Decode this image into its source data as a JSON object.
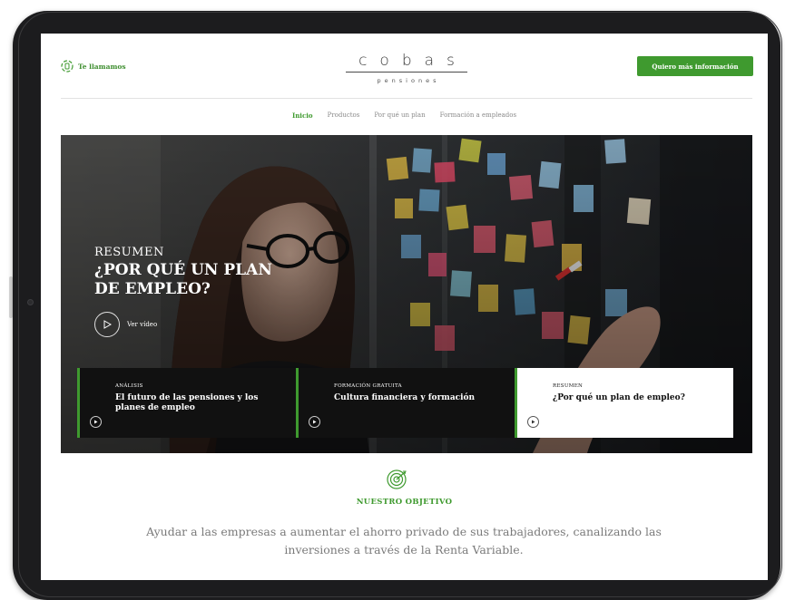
{
  "header": {
    "call_label": "Te llamamos",
    "logo_main": "cobas",
    "logo_sub": "pensiones",
    "cta_label": "Quiero más información"
  },
  "nav": {
    "items": [
      {
        "label": "Inicio",
        "active": true
      },
      {
        "label": "Productos",
        "active": false
      },
      {
        "label": "Por qué un plan",
        "active": false
      },
      {
        "label": "Formación a empleados",
        "active": false
      }
    ]
  },
  "hero": {
    "kicker": "RESUMEN",
    "title": "¿POR QUÉ UN PLAN DE EMPLEO?",
    "video_label": "Ver vídeo"
  },
  "cards": [
    {
      "kicker": "ANÁLISIS",
      "title": "El futuro de las pensiones y los planes de empleo",
      "style": "dark"
    },
    {
      "kicker": "FORMACIÓN GRATUITA",
      "title": "Cultura financiera y formación",
      "style": "dark"
    },
    {
      "kicker": "RESUMEN",
      "title": "¿Por qué un plan de empleo?",
      "style": "light"
    }
  ],
  "objective": {
    "icon": "target-icon",
    "label": "NUESTRO OBJETIVO",
    "text": "Ayudar a las empresas a aumentar el ahorro privado de sus trabajadores, canalizando las inversiones a través de la Renta Variable."
  },
  "colors": {
    "brand_green": "#3f9a2f",
    "tablet_frame": "#1c1c1e",
    "card_dark": "#111111"
  }
}
